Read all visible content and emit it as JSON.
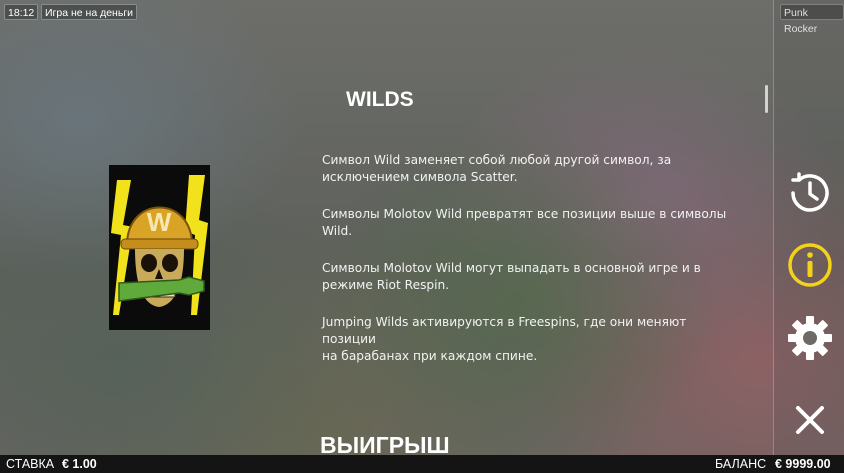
{
  "status_bar": {
    "time": "18:12",
    "mode": "Игра не на деньги",
    "game_name": "Punk Rocker"
  },
  "section": {
    "title": "WILDS",
    "paragraphs": [
      {
        "line1": "Символ Wild заменяет собой любой другой символ, за",
        "line2": "исключением символа Scatter."
      },
      {
        "line1": "Символы Molotov Wild превратят все позиции выше в символы",
        "line2": "Wild."
      },
      {
        "line1": "Символы Molotov Wild могут выпадать в основной игре и в",
        "line2": "режиме Riot Respin."
      },
      {
        "line1": "Jumping Wilds активируются в Freespins, где они меняют позиции",
        "line2": "на барабанах при каждом спине."
      }
    ],
    "symbol_letter": "W",
    "next_title": "ВЫИГРЫШ"
  },
  "side_buttons": [
    {
      "icon": "history-clock-icon"
    },
    {
      "icon": "info-icon",
      "color": "#f2d21b"
    },
    {
      "icon": "gear-icon"
    },
    {
      "icon": "close-icon"
    }
  ],
  "bottom_bar": {
    "bet_label": "СТАВКА",
    "bet_value": "€ 1.00",
    "balance_label": "БАЛАНС",
    "balance_value": "€ 9999.00"
  }
}
